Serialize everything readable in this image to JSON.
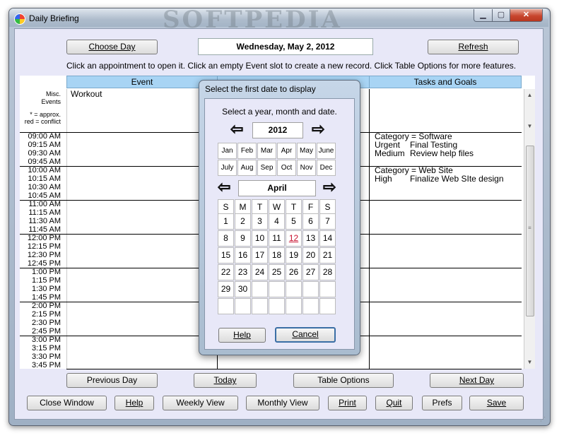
{
  "window": {
    "title": "Daily Briefing",
    "watermark": "SOFTPEDIA",
    "minimize_glyph": "▁",
    "maximize_glyph": "▢",
    "close_glyph": "✕"
  },
  "top": {
    "choose_day_label": "Choose Day",
    "current_date": "Wednesday, May 2, 2012",
    "refresh_label": "Refresh",
    "instructions": "Click an appointment to open it. Click an empty Event slot to create a new record. Click Table Options for more features."
  },
  "columns": {
    "event": "Event",
    "tasks": "Tasks and Goals"
  },
  "sidebar": {
    "misc_events_line1": "Misc.",
    "misc_events_line2": "Events",
    "legend_line1": "* = approx.",
    "legend_line2": "red = conflict"
  },
  "misc_event": "Workout",
  "times": [
    "09:00 AM",
    "09:15 AM",
    "09:30 AM",
    "09:45 AM",
    "10:00 AM",
    "10:15 AM",
    "10:30 AM",
    "10:45 AM",
    "11:00 AM",
    "11:15 AM",
    "11:30 AM",
    "11:45 AM",
    "12:00 PM",
    "12:15 PM",
    "12:30 PM",
    "12:45 PM",
    "1:00 PM",
    "1:15 PM",
    "1:30 PM",
    "1:45 PM",
    "2:00 PM",
    "2:15 PM",
    "2:30 PM",
    "2:45 PM",
    "3:00 PM",
    "3:15 PM",
    "3:30 PM",
    "3:45 PM"
  ],
  "tasks": [
    {
      "category": "Category = Software",
      "items": [
        {
          "priority": "Urgent",
          "text": "Final Testing"
        },
        {
          "priority": "Medium",
          "text": "Review help files"
        }
      ]
    },
    {
      "category": "Category = Web Site",
      "items": [
        {
          "priority": "High",
          "text": "Finalize Web SIte design"
        }
      ]
    }
  ],
  "dialog": {
    "title": "Select the first date to display",
    "prompt": "Select a year, month and date.",
    "year": "2012",
    "month": "April",
    "months": [
      "Jan",
      "Feb",
      "Mar",
      "Apr",
      "May",
      "June",
      "July",
      "Aug",
      "Sep",
      "Oct",
      "Nov",
      "Dec"
    ],
    "weekdays": [
      "S",
      "M",
      "T",
      "W",
      "T",
      "F",
      "S"
    ],
    "days": [
      [
        "1",
        "2",
        "3",
        "4",
        "5",
        "6",
        "7"
      ],
      [
        "8",
        "9",
        "10",
        "11",
        "12",
        "13",
        "14"
      ],
      [
        "15",
        "16",
        "17",
        "18",
        "19",
        "20",
        "21"
      ],
      [
        "22",
        "23",
        "24",
        "25",
        "26",
        "27",
        "28"
      ],
      [
        "29",
        "30",
        "",
        "",
        "",
        "",
        ""
      ],
      [
        "",
        "",
        "",
        "",
        "",
        "",
        ""
      ]
    ],
    "highlighted_day": "12",
    "help_label": "Help",
    "cancel_label": "Cancel",
    "arrow_left": "⇦",
    "arrow_right": "⇨"
  },
  "nav": {
    "previous_day": "Previous Day",
    "today": "Today",
    "table_options": "Table Options",
    "next_day": "Next Day"
  },
  "bottom": {
    "close_window": "Close Window",
    "help": "Help",
    "weekly_view": "Weekly View",
    "monthly_view": "Monthly View",
    "print": "Print",
    "quit": "Quit",
    "prefs": "Prefs",
    "save": "Save"
  },
  "colors": {
    "client_bg": "#e8e8f8",
    "header_bg": "#a8d4f4",
    "conflict_red": "#c8102e"
  }
}
